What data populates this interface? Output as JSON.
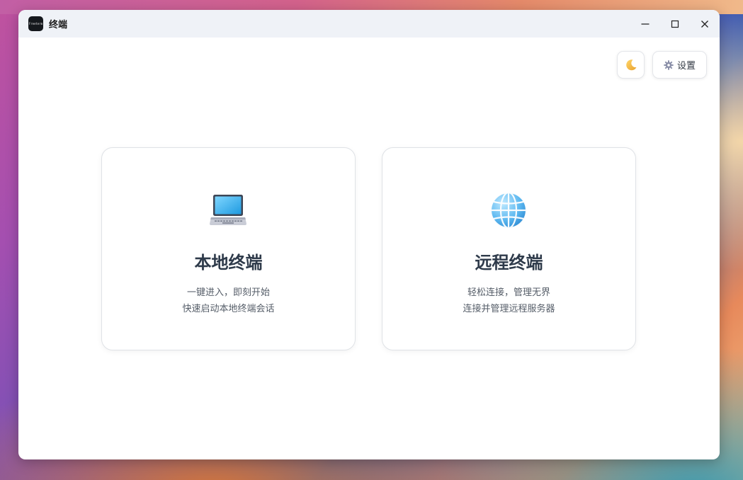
{
  "window": {
    "title": "终端",
    "app_icon_text": "Freeterm"
  },
  "toolbar": {
    "theme_toggle_icon": "crescent-moon",
    "settings_label": "设置",
    "settings_icon": "gear"
  },
  "cards": [
    {
      "icon": "laptop",
      "title": "本地终端",
      "desc_line1": "一键进入，即刻开始",
      "desc_line2": "快速启动本地终端会话"
    },
    {
      "icon": "globe",
      "title": "远程终端",
      "desc_line1": "轻松连接，管理无界",
      "desc_line2": "连接并管理远程服务器"
    }
  ],
  "colors": {
    "titlebar_bg": "#eff2f7",
    "card_title": "#2e3a4a",
    "card_desc": "#555d68",
    "laptop_screen": "#3bb6f0",
    "globe": "#4aa8e8",
    "moon": "#f6c04a"
  }
}
